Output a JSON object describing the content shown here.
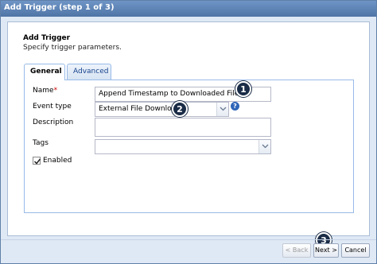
{
  "window": {
    "title": "Add Trigger (step 1 of 3)"
  },
  "header": {
    "title": "Add Trigger",
    "subtitle": "Specify trigger parameters."
  },
  "tabs": [
    {
      "label": "General",
      "active": true
    },
    {
      "label": "Advanced",
      "active": false
    }
  ],
  "form": {
    "name_label": "Name",
    "name_required_mark": "*",
    "name_value": "Append Timestamp to Downloaded Files",
    "event_type_label": "Event type",
    "event_type_value": "External File Download",
    "description_label": "Description",
    "description_value": "",
    "tags_label": "Tags",
    "tags_value": "",
    "enabled_label": "Enabled",
    "enabled_checked": true,
    "help_icon": "question-icon"
  },
  "callouts": [
    "1",
    "2",
    "3"
  ],
  "buttons": {
    "back": "< Back",
    "next": "Next >",
    "cancel": "Cancel"
  },
  "colors": {
    "titlebar": "#5a80b3",
    "callout": "#1a2c46",
    "help": "#2f66b8",
    "required": "#cc0000"
  }
}
